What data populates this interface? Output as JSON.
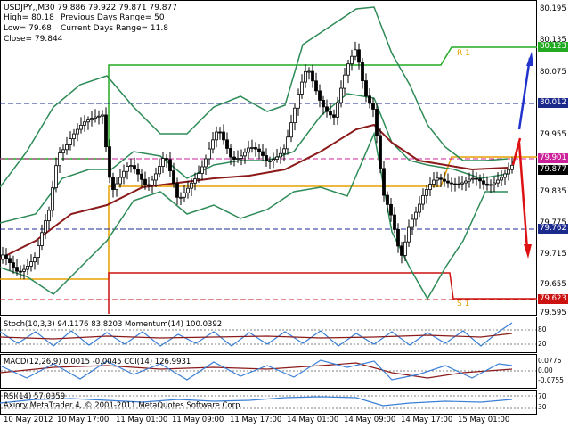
{
  "header": {
    "symbol_ohlc": "USDJPY,,M30  79.886 79.922 79.871 79.877",
    "high": "High= 80.18",
    "prev_range": "Previous Days Range= 50",
    "low": "Low= 79.68",
    "curr_range": "Current Days Range= 11.8",
    "close": "Close= 79.844"
  },
  "price_axis": {
    "labels": [
      "80.195",
      "80.135",
      "80.075",
      "79.955",
      "79.835",
      "79.775",
      "79.715",
      "79.655",
      "79.595"
    ],
    "highlights": [
      {
        "text": "80.123",
        "color": "#22aa22"
      },
      {
        "text": "80.012",
        "color": "#1c2a8c"
      },
      {
        "text": "79.901",
        "color": "#cc2299"
      },
      {
        "text": "79.877",
        "color": "#000000"
      },
      {
        "text": "79.762",
        "color": "#1c2a8c"
      },
      {
        "text": "79.623",
        "color": "#cc1111"
      }
    ]
  },
  "pivot_labels": {
    "r1": "R 1",
    "s1": "S 1"
  },
  "indicators": {
    "stoch": "Stoch(10,3,3) 94.1176 83.8203  Momentum(14) 100.0392",
    "macd": "MACD(12,26,9) 0.0015 -0.0045  CCI(14) 126.9931",
    "rsi": "RSI(14) 57.0359"
  },
  "sub_axes": {
    "stoch": [
      "80",
      "20"
    ],
    "macd": [
      "0.0776",
      "0.00",
      "-0.0755"
    ],
    "rsi": [
      "70",
      "30"
    ]
  },
  "footer": {
    "copyright": "Axiory MetaTrader 4, © 2001-2011 MetaQuotes Software Corp."
  },
  "time_axis": [
    "10 May 2012",
    "10 May 17:00",
    "11 May 01:00",
    "11 May 09:00",
    "11 May 17:00",
    "14 May 01:00",
    "14 May 09:00",
    "14 May 17:00",
    "15 May 01:00"
  ],
  "colors": {
    "bull_candle": "#ffffff",
    "bear_candle": "#000000",
    "bollinger": "#2e8b57",
    "ma": "#8b1a1a",
    "pivot_green": "#22aa22",
    "pivot_orange": "#e6a100",
    "pivot_red": "#cc1111",
    "arrow_up": "#2233cc",
    "arrow_down": "#dd1111"
  },
  "icons": [
    "up-arrow-icon",
    "down-arrow-icon"
  ]
}
